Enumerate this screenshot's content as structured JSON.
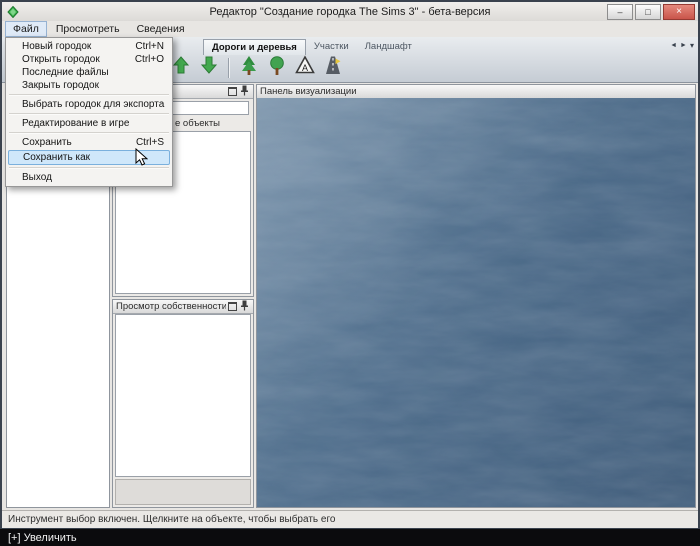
{
  "window": {
    "title": "Редактор \"Создание городка The Sims 3\" - бета-версия"
  },
  "titlebar": {
    "minimize": "–",
    "maximize": "□",
    "close": "×"
  },
  "menubar": {
    "items": [
      {
        "label": "Файл"
      },
      {
        "label": "Просмотреть"
      },
      {
        "label": "Сведения"
      }
    ]
  },
  "file_menu": {
    "items": [
      {
        "label": "Новый городок",
        "shortcut": "Ctrl+N"
      },
      {
        "label": "Открыть городок",
        "shortcut": "Ctrl+O"
      },
      {
        "label": "Последние файлы",
        "shortcut": ""
      },
      {
        "label": "Закрыть городок",
        "shortcut": ""
      },
      {
        "label": "Выбрать городок для экспорта",
        "shortcut": ""
      },
      {
        "label": "Редактирование в игре",
        "shortcut": ""
      },
      {
        "label": "Сохранить",
        "shortcut": "Ctrl+S"
      },
      {
        "label": "Сохранить как",
        "shortcut": ""
      },
      {
        "label": "Выход",
        "shortcut": ""
      }
    ]
  },
  "toolbar": {
    "tabs": [
      {
        "label": "Дороги и деревья",
        "active": true
      },
      {
        "label": "Участки",
        "active": false
      },
      {
        "label": "Ландшафт",
        "active": false
      }
    ],
    "icons": [
      "arrow-up",
      "arrow-down",
      "tree-pine",
      "tree-round",
      "road-sign",
      "road"
    ]
  },
  "panels": {
    "objects": {
      "search_value": "",
      "label_fragment": "е объекты"
    },
    "property": {
      "title": "Просмотр собственности"
    },
    "render": {
      "title": "Панель визуализации"
    }
  },
  "statusbar": {
    "text": "Инструмент выбор включен. Щелкните на объекте, чтобы выбрать его"
  },
  "overlay": {
    "zoom_label": "[+] Увеличить"
  },
  "colors": {
    "menu_highlight": "#cfe7fa",
    "menu_highlight_border": "#7ab0dd",
    "water_base": "#4d6b89",
    "close_red": "#c9544a",
    "chrome_gray": "#e8e6e3"
  }
}
